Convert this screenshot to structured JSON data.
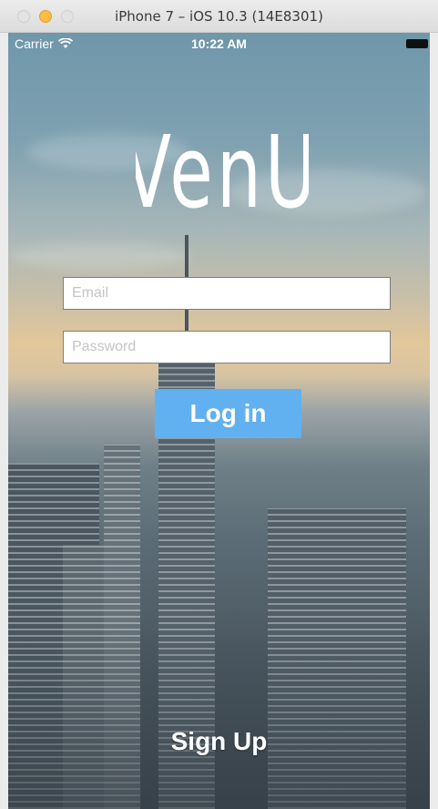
{
  "window": {
    "title": "iPhone 7 – iOS 10.3 (14E8301)"
  },
  "status_bar": {
    "carrier": "Carrier",
    "time": "10:22 AM",
    "wifi_icon": "wifi-icon",
    "battery_icon": "battery-icon"
  },
  "app": {
    "logo_text": "VenU",
    "email_placeholder": "Email",
    "email_value": "",
    "password_placeholder": "Password",
    "password_value": "",
    "login_label": "Log in",
    "signup_label": "Sign Up"
  },
  "colors": {
    "login_button": "#61b1f1",
    "text": "#ffffff"
  }
}
